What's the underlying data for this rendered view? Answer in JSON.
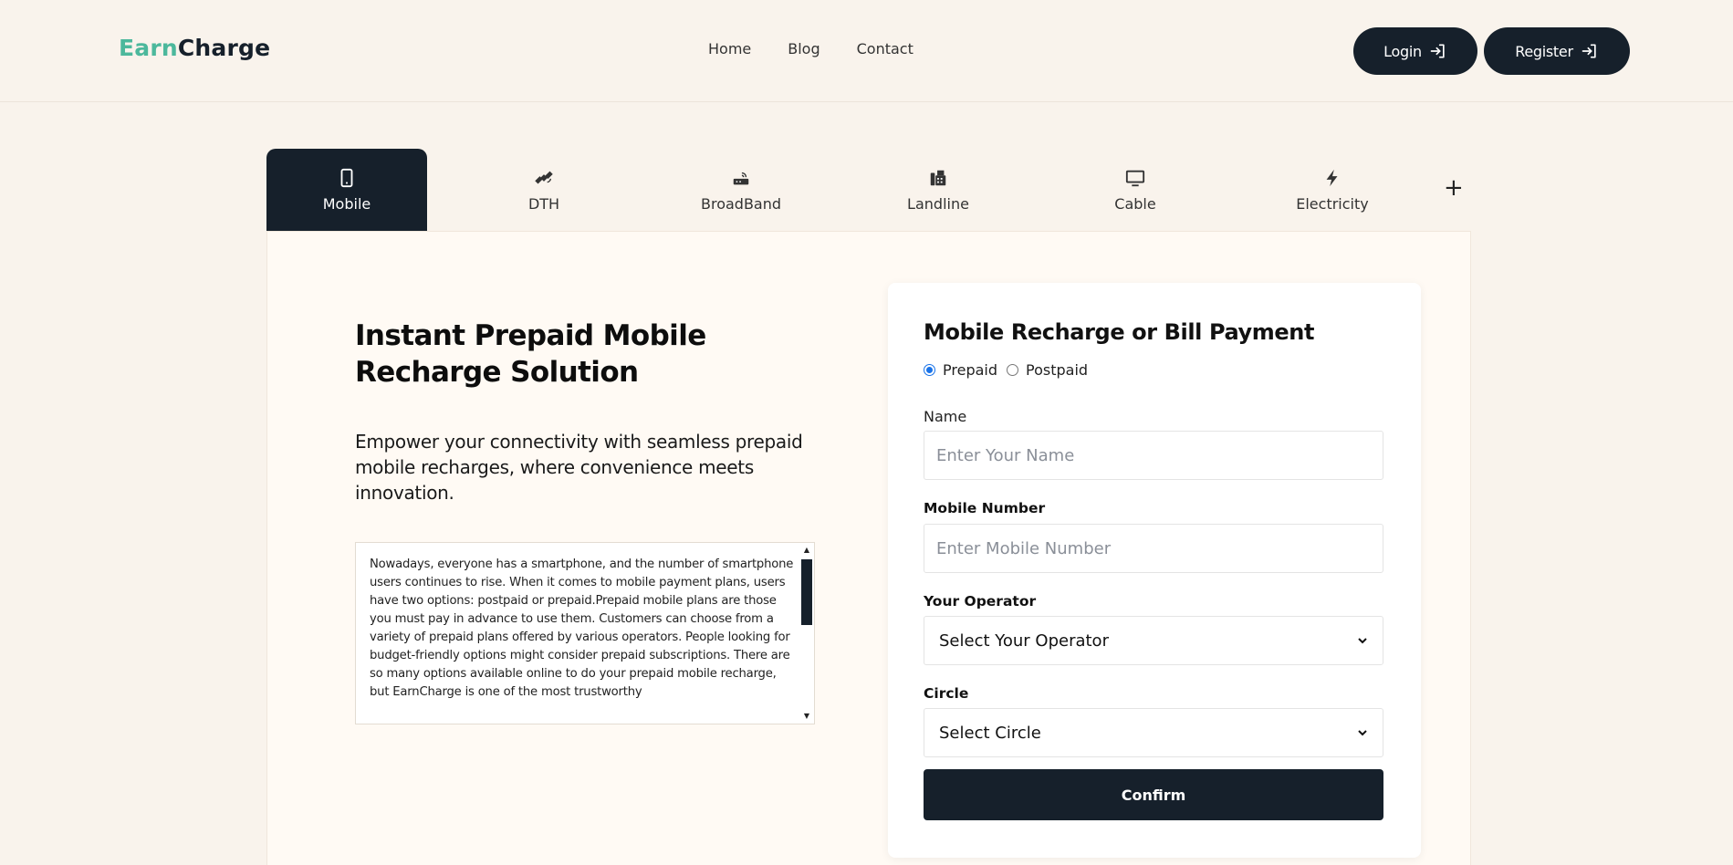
{
  "brand": {
    "part1": "Earn",
    "part2": "Charge"
  },
  "nav": {
    "home": "Home",
    "blog": "Blog",
    "contact": "Contact"
  },
  "auth": {
    "login": "Login",
    "register": "Register"
  },
  "tabs": [
    {
      "label": "Mobile",
      "icon": "mobile-phone-icon"
    },
    {
      "label": "DTH",
      "icon": "satellite-icon"
    },
    {
      "label": "BroadBand",
      "icon": "router-icon"
    },
    {
      "label": "Landline",
      "icon": "fax-phone-icon"
    },
    {
      "label": "Cable",
      "icon": "tv-icon"
    },
    {
      "label": "Electricity",
      "icon": "lightning-icon"
    }
  ],
  "more_tabs": "+",
  "hero": {
    "title": "Instant Prepaid Mobile Recharge Solution",
    "subtitle": "Empower your connectivity with seamless prepaid mobile recharges, where convenience meets innovation.",
    "info": "Nowadays, everyone has a smartphone, and the number of smartphone users continues to rise. When it comes to mobile payment plans, users have two options: postpaid or prepaid.Prepaid mobile plans are those you must pay in advance to use them. Customers can choose from a variety of prepaid plans offered by various operators. People looking for budget-friendly options might consider prepaid subscriptions. There are so many options available online to do your prepaid mobile recharge, but EarnCharge is one of the most trustworthy"
  },
  "form": {
    "title": "Mobile Recharge or Bill Payment",
    "prepaid": "Prepaid",
    "postpaid": "Postpaid",
    "name_label": "Name",
    "name_placeholder": "Enter Your Name",
    "mobile_label": "Mobile Number",
    "mobile_placeholder": "Enter Mobile Number",
    "operator_label": "Your Operator",
    "operator_value": "Select Your Operator",
    "circle_label": "Circle",
    "circle_value": "Select Circle",
    "confirm": "Confirm"
  },
  "colors": {
    "accent": "#16202b",
    "brand_green": "#4cb89c",
    "background": "#f9f3ec",
    "radio": "#1a73e8"
  }
}
